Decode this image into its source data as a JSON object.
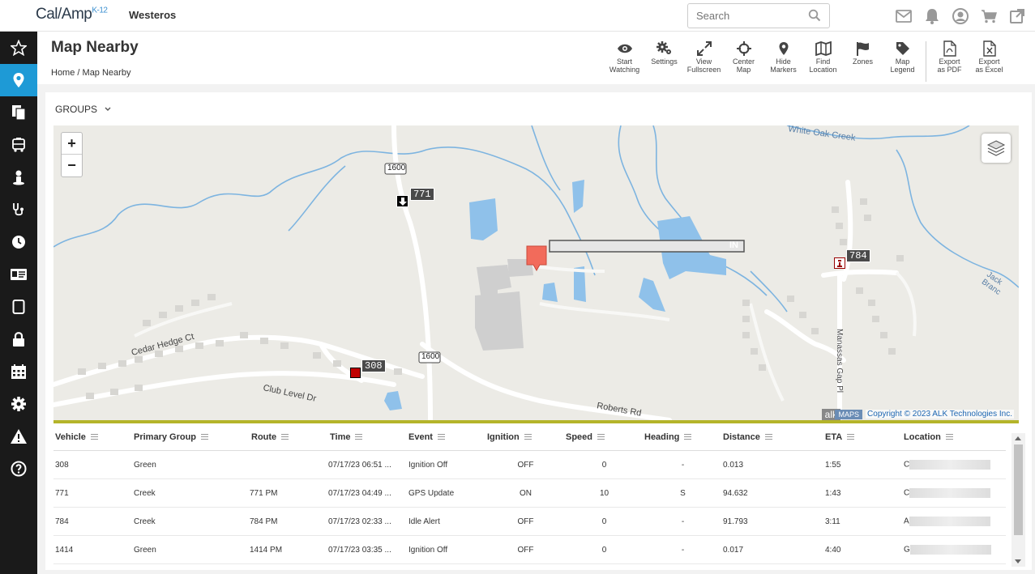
{
  "app": {
    "brand": "Cal/Amp",
    "brand_sub": "K-12",
    "org": "Westeros",
    "search_placeholder": "Search",
    "top_icons": [
      "mail-icon",
      "bell-icon",
      "user-icon",
      "cart-icon",
      "external-link-icon"
    ]
  },
  "sidebar": {
    "items": [
      "star-icon",
      "map-pin-icon",
      "documents-icon",
      "bus-icon",
      "person-icon",
      "stethoscope-icon",
      "clock-icon",
      "id-card-icon",
      "tablet-icon",
      "lock-icon",
      "calendar-icon",
      "gear-icon",
      "warning-icon",
      "help-icon"
    ],
    "active_index": 1
  },
  "page": {
    "title": "Map Nearby",
    "breadcrumb_home": "Home",
    "breadcrumb_sep": "/",
    "breadcrumb_current": "Map Nearby"
  },
  "toolbar": [
    {
      "icon": "eye-icon",
      "line1": "Start",
      "line2": "Watching"
    },
    {
      "icon": "gears-icon",
      "line1": "Settings",
      "line2": ""
    },
    {
      "icon": "expand-icon",
      "line1": "View",
      "line2": "Fullscreen"
    },
    {
      "icon": "crosshair-icon",
      "line1": "Center",
      "line2": "Map"
    },
    {
      "icon": "pin-icon",
      "line1": "Hide",
      "line2": "Markers"
    },
    {
      "icon": "map-icon",
      "line1": "Find",
      "line2": "Location"
    },
    {
      "icon": "flag-icon",
      "line1": "Zones",
      "line2": ""
    },
    {
      "icon": "tag-icon",
      "line1": "Map",
      "line2": "Legend"
    },
    {
      "icon": "pdf-icon",
      "line1": "Export",
      "line2": "as PDF"
    },
    {
      "icon": "excel-icon",
      "line1": "Export",
      "line2": "as Excel"
    }
  ],
  "groups_label": "GROUPS",
  "map": {
    "zoom_in": "+",
    "zoom_out": "−",
    "copyright": "Copyright © 2023 ALK Technologies Inc.",
    "maps_badge": "MAPS",
    "alk": "alk",
    "labels": {
      "road1600a": "1600",
      "road1600b": "1600",
      "creek": "White Oak Creek",
      "cedar": "Cedar Hedge Ct",
      "club": "Club Level Dr",
      "roberts": "Roberts Rd",
      "manassas": "Manassas Gap Pl",
      "jack": "Jack Branc"
    },
    "markers": {
      "m771": "771",
      "m784": "784",
      "m308": "308",
      "zone_in": "IN"
    },
    "colors": {
      "water": "#8fc1ea",
      "stream": "#7db4e0",
      "road": "#ffffff",
      "building": "#cfcfcf",
      "zone_marker": "#f26b5b",
      "stop_marker": "#c00000"
    }
  },
  "table": {
    "columns": [
      "Vehicle",
      "Primary Group",
      "Route",
      "Time",
      "Event",
      "Ignition",
      "Speed",
      "Heading",
      "Distance",
      "ETA",
      "Location"
    ],
    "rows": [
      {
        "vehicle": "308",
        "group": "Green",
        "route": "",
        "time": "07/17/23 06:51 ...",
        "event": "Ignition Off",
        "ignition": "OFF",
        "speed": "0",
        "heading": "-",
        "distance": "0.013",
        "eta": "1:55",
        "loc": "C"
      },
      {
        "vehicle": "771",
        "group": "Creek",
        "route": "771 PM",
        "time": "07/17/23 04:49 ...",
        "event": "GPS Update",
        "ignition": "ON",
        "speed": "10",
        "heading": "S",
        "distance": "94.632",
        "eta": "1:43",
        "loc": "C"
      },
      {
        "vehicle": "784",
        "group": "Creek",
        "route": "784 PM",
        "time": "07/17/23 02:33 ...",
        "event": "Idle Alert",
        "ignition": "OFF",
        "speed": "0",
        "heading": "-",
        "distance": "91.793",
        "eta": "3:11",
        "loc": "A"
      },
      {
        "vehicle": "1414",
        "group": "Green",
        "route": "1414 PM",
        "time": "07/17/23 03:35 ...",
        "event": "Ignition Off",
        "ignition": "OFF",
        "speed": "0",
        "heading": "-",
        "distance": "0.017",
        "eta": "4:40",
        "loc": "G"
      }
    ]
  }
}
